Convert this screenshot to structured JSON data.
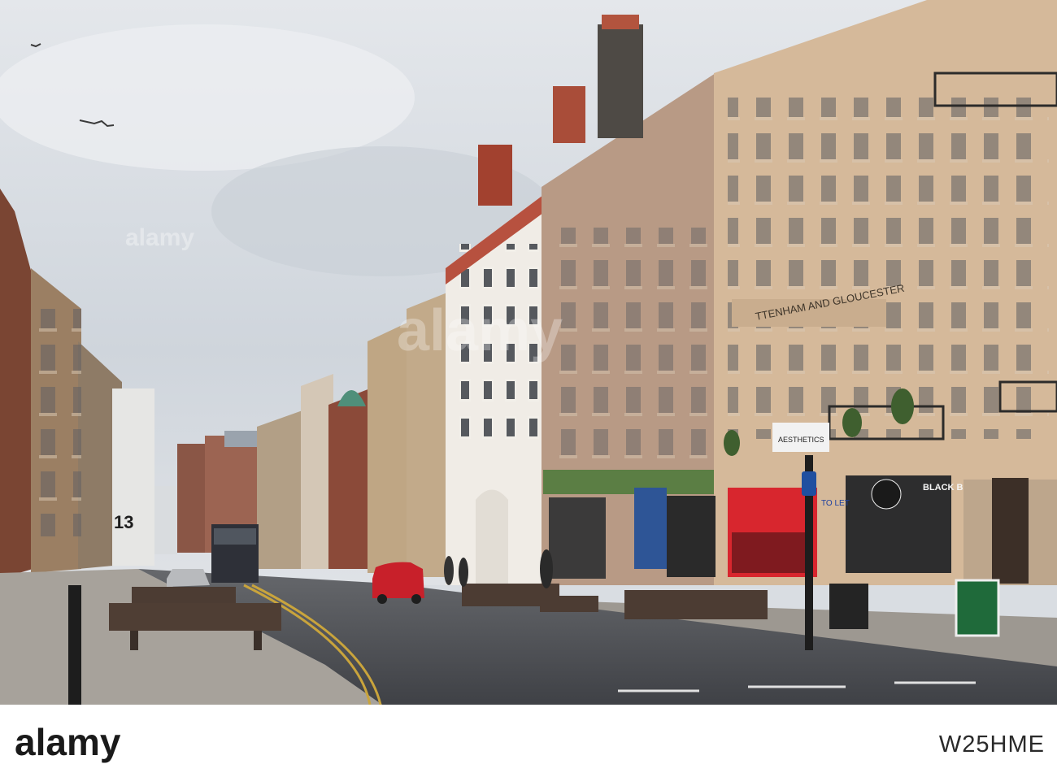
{
  "photo": {
    "subject": "street-scene",
    "colors": {
      "sky": "#cfd5dc",
      "road": "#4d4f54",
      "pavement": "#a7a29b",
      "sandstone": "#c9ae92",
      "red_brick": "#9c5a45",
      "shop_red": "#d8262e"
    },
    "signs": {
      "facade_lettering": "TTENHAM AND GLOUCESTER",
      "shop_black_barrel": "BLACK BARREL",
      "shop_aesthetics": "AESTHETICS",
      "building_number": "13",
      "to_let": "TO LET"
    }
  },
  "watermark": {
    "brand": "alamy"
  },
  "footer": {
    "logo_text": "alamy",
    "image_id": "W25HME"
  }
}
